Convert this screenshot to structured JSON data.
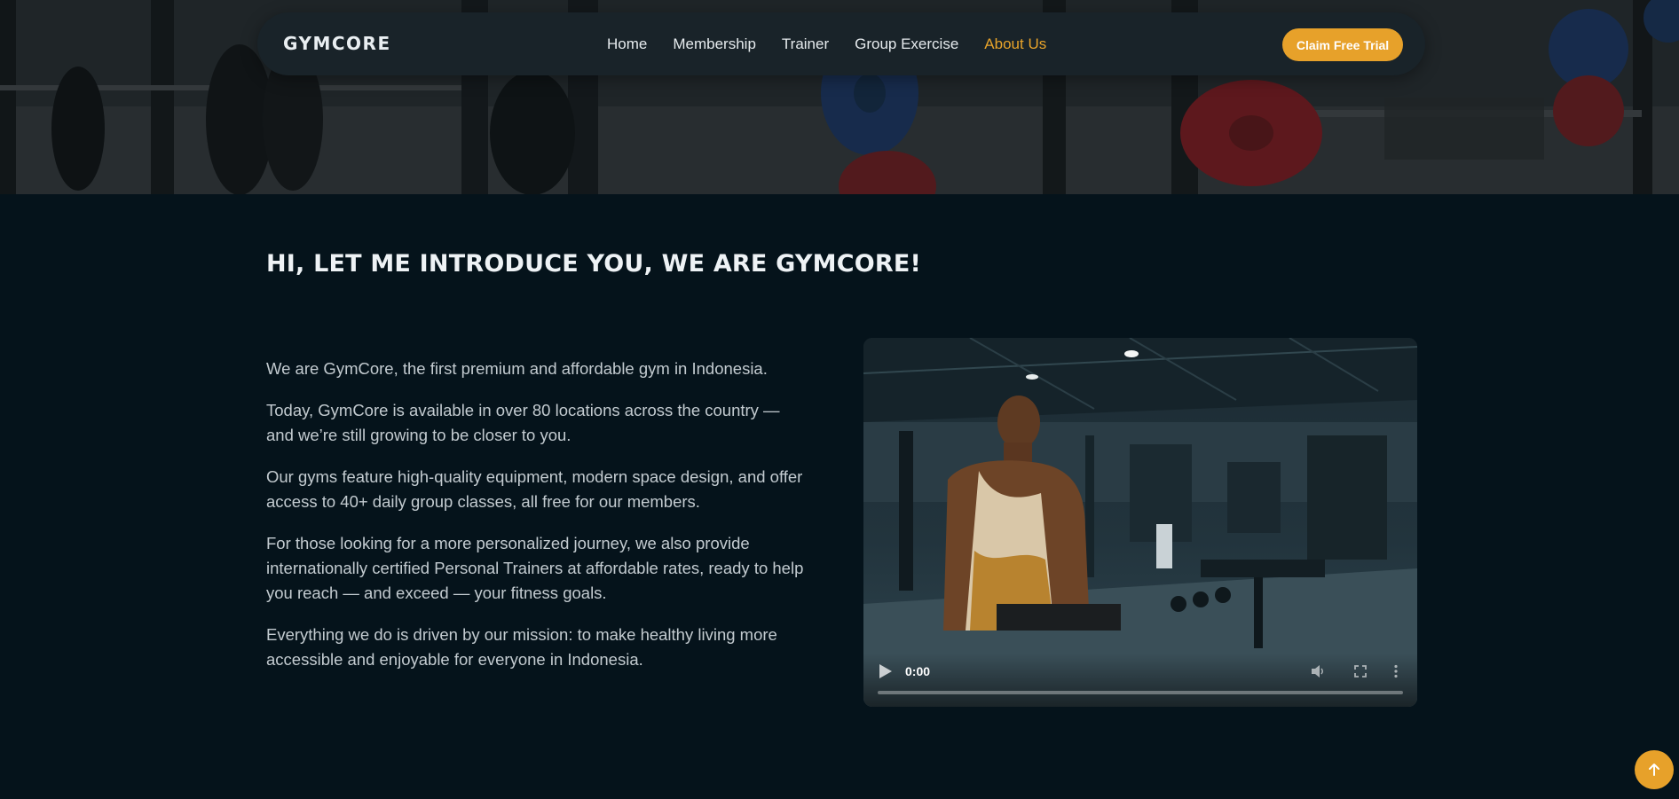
{
  "brand": {
    "logo": "GYMCORE"
  },
  "nav": {
    "items": [
      {
        "label": "Home",
        "active": false
      },
      {
        "label": "Membership",
        "active": false
      },
      {
        "label": "Trainer",
        "active": false
      },
      {
        "label": "Group Exercise",
        "active": false
      },
      {
        "label": "About Us",
        "active": true
      }
    ],
    "cta_label": "Claim Free Trial"
  },
  "about": {
    "title": "HI, LET ME INTRODUCE YOU, WE ARE GYMCORE!",
    "paragraphs": [
      "We are GymCore, the first premium and affordable gym in Indonesia.",
      "Today, GymCore is available in over 80 locations across the country — and we’re still growing to be closer to you.",
      "Our gyms feature high-quality equipment, modern space design, and offer access to 40+ daily group classes, all free for our members.",
      "For those looking for a more personalized journey, we also provide internationally certified Personal Trainers at affordable rates, ready to help you reach — and exceed — your fitness goals.",
      "Everything we do is driven by our mission: to make healthy living more accessible and enjoyable for everyone in Indonesia."
    ]
  },
  "video": {
    "time": "0:00",
    "progress": 0
  },
  "icons": {
    "play": "play-icon",
    "volume": "volume-icon",
    "fullscreen": "fullscreen-icon",
    "more": "more-vertical-icon",
    "scroll_top": "arrow-up-icon"
  },
  "colors": {
    "accent": "#e7a12a",
    "background": "#05131b",
    "navbar": "#192329"
  }
}
